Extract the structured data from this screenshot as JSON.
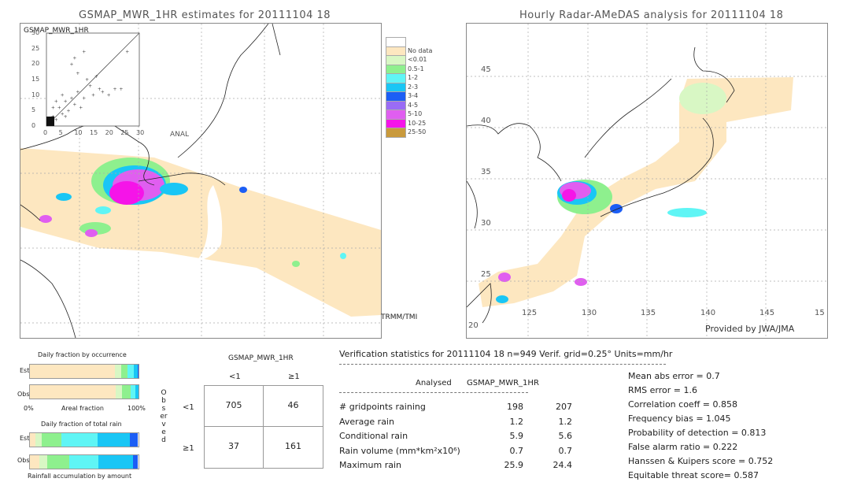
{
  "left_panel": {
    "title": "GSMAP_MWR_1HR estimates for 20111104 18",
    "inset": {
      "title": "GSMAP_MWR_1HR",
      "xlabel": "ANAL",
      "ticks": [
        "0",
        "5",
        "10",
        "15",
        "20",
        "25",
        "30"
      ]
    },
    "sensor_label": "TRMM/TMI"
  },
  "right_panel": {
    "title": "Hourly Radar-AMeDAS analysis for 20111104 18",
    "lat_labels": [
      "45",
      "40",
      "35",
      "30",
      "25",
      "20"
    ],
    "lon_labels": [
      "125",
      "130",
      "135",
      "140",
      "145",
      "15"
    ],
    "credit": "Provided by JWA/JMA"
  },
  "legend": {
    "items": [
      {
        "label": "",
        "color": "#ffffff"
      },
      {
        "label": "No data",
        "color": "#fde7c0"
      },
      {
        "label": "<0.01",
        "color": "#d8f7c4"
      },
      {
        "label": "0.5-1",
        "color": "#8ef08e"
      },
      {
        "label": "1-2",
        "color": "#5ff5f5"
      },
      {
        "label": "2-3",
        "color": "#19c6f5"
      },
      {
        "label": "3-4",
        "color": "#1c5ef5"
      },
      {
        "label": "4-5",
        "color": "#9a6cf5"
      },
      {
        "label": "5-10",
        "color": "#e05ef0"
      },
      {
        "label": "10-25",
        "color": "#f514e8"
      },
      {
        "label": "25-50",
        "color": "#c99a3c"
      }
    ]
  },
  "fractions": {
    "occurrence_title": "Daily fraction by occurrence",
    "est_label": "Est",
    "obs_label": "Obs",
    "axis_left": "0%",
    "axis_mid": "Areal fraction",
    "axis_right": "100%",
    "rain_title": "Daily fraction of total rain",
    "rain_caption": "Rainfall accumulation by amount"
  },
  "contingency": {
    "header": "GSMAP_MWR_1HR",
    "col_labels": [
      "<1",
      "≥1"
    ],
    "row_labels": [
      "<1",
      "≥1"
    ],
    "side_label": "Observed",
    "cells": [
      [
        "705",
        "46"
      ],
      [
        "37",
        "161"
      ]
    ]
  },
  "verification": {
    "header": "Verification statistics for 20111104 18   n=949   Verif. grid=0.25°   Units=mm/hr",
    "col_analysed": "Analysed",
    "col_estimate": "GSMAP_MWR_1HR",
    "rows": [
      {
        "label": "# gridpoints raining",
        "analysed": "198",
        "estimate": "207"
      },
      {
        "label": "Average rain",
        "analysed": "1.2",
        "estimate": "1.2"
      },
      {
        "label": "Conditional rain",
        "analysed": "5.9",
        "estimate": "5.6"
      },
      {
        "label": "Rain volume (mm*km²x10⁶)",
        "analysed": "0.7",
        "estimate": "0.7"
      },
      {
        "label": "Maximum rain",
        "analysed": "25.9",
        "estimate": "24.4"
      }
    ],
    "scores": [
      "Mean abs error = 0.7",
      "RMS error = 1.6",
      "Correlation coeff = 0.858",
      "Frequency bias = 1.045",
      "Probability of detection = 0.813",
      "False alarm ratio = 0.222",
      "Hanssen & Kuipers score = 0.752",
      "Equitable threat score= 0.587"
    ]
  },
  "chart_data": [
    {
      "type": "bar",
      "title": "Daily fraction by occurrence",
      "xlabel": "Areal fraction",
      "xlim": [
        0,
        100
      ],
      "categories": [
        "Est",
        "Obs"
      ],
      "series": [
        {
          "name": "No data/no rain",
          "color": "#fde7c0",
          "values": [
            78,
            79
          ]
        },
        {
          "name": "<0.01",
          "color": "#d8f7c4",
          "values": [
            6,
            6
          ]
        },
        {
          "name": "0.5-1",
          "color": "#8ef08e",
          "values": [
            6,
            8
          ]
        },
        {
          "name": "1-2",
          "color": "#5ff5f5",
          "values": [
            6,
            4
          ]
        },
        {
          "name": "2-3",
          "color": "#19c6f5",
          "values": [
            3,
            3
          ]
        },
        {
          "name": "3-4",
          "color": "#1c5ef5",
          "values": [
            1,
            0
          ]
        }
      ]
    },
    {
      "type": "bar",
      "title": "Daily fraction of total rain",
      "xlabel": "Rainfall accumulation by amount",
      "xlim": [
        0,
        100
      ],
      "categories": [
        "Est",
        "Obs"
      ],
      "series": [
        {
          "name": "No data/no rain",
          "color": "#fde7c0",
          "values": [
            5,
            9
          ]
        },
        {
          "name": "<0.01",
          "color": "#d8f7c4",
          "values": [
            6,
            7
          ]
        },
        {
          "name": "0.5-1",
          "color": "#8ef08e",
          "values": [
            18,
            20
          ]
        },
        {
          "name": "1-2",
          "color": "#5ff5f5",
          "values": [
            33,
            27
          ]
        },
        {
          "name": "2-3",
          "color": "#19c6f5",
          "values": [
            30,
            32
          ]
        },
        {
          "name": "3-4",
          "color": "#1c5ef5",
          "values": [
            7,
            4
          ]
        }
      ]
    },
    {
      "type": "scatter",
      "title": "GSMAP_MWR_1HR",
      "xlabel": "ANAL",
      "ylabel": "GSMAP_MWR_1HR",
      "xlim": [
        0,
        30
      ],
      "ylim": [
        0,
        30
      ],
      "points": [
        [
          1,
          1
        ],
        [
          2,
          3
        ],
        [
          3,
          2
        ],
        [
          4,
          6
        ],
        [
          5,
          4
        ],
        [
          6,
          8
        ],
        [
          7,
          5
        ],
        [
          8,
          9
        ],
        [
          9,
          7
        ],
        [
          10,
          11
        ],
        [
          11,
          6
        ],
        [
          12,
          9
        ],
        [
          14,
          13
        ],
        [
          15,
          10
        ],
        [
          17,
          12
        ],
        [
          18,
          11
        ],
        [
          20,
          10
        ],
        [
          22,
          12
        ],
        [
          24,
          12
        ],
        [
          26,
          24
        ],
        [
          8,
          20
        ],
        [
          9,
          22
        ],
        [
          10,
          17
        ],
        [
          12,
          24
        ],
        [
          3,
          8
        ],
        [
          5,
          10
        ],
        [
          6,
          3
        ],
        [
          2,
          6
        ],
        [
          13,
          15
        ],
        [
          16,
          16
        ]
      ]
    }
  ]
}
